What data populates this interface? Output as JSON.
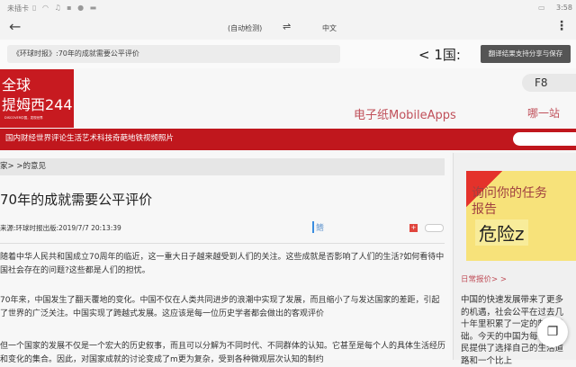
{
  "status_bar": {
    "left": "未插卡",
    "time": "3:58"
  },
  "toolbar": {
    "source_lang": "(自动检测)",
    "swap": "⇌",
    "target_lang": "中文"
  },
  "url_bar": {
    "value": "《环球时报》:70年的成就需要公平评价",
    "overlay": "< 1国:"
  },
  "tooltip": "翻译结果支持分享与保存",
  "site": {
    "logo_line1": "全球",
    "logo_line2": "提姆西244",
    "logo_tagline": "DISCOVER中国，发现世界",
    "apps_link": "电子纸MobileApps",
    "f8": "F8",
    "station": "哪一站"
  },
  "nav": {
    "items": "国内财经世界评论生活艺术科技奇葩地铁视频照片"
  },
  "breadcrumb": "家> >的意见",
  "article": {
    "title": "70年的成就需要公平评价",
    "meta": "来源:环球时报出版:2019/7/7 20:13:39",
    "font_label": "鳍",
    "paragraphs": [
      "随着中华人民共和国成立70周年的临近，这一重大日子越来越受到人们的关注。这些成就是否影响了人们的生活?如何看待中国社会存在的问题?这些都是人们的担忧。",
      "70年来，中国发生了翻天覆地的变化。中国不仅在人类共同进步的浪潮中实现了发展，而且缩小了与发达国家的差距，引起了世界的广泛关注。中国实现了跨越式发展。这应该是每一位历史学者都会做出的客观评价",
      "但一个国家的发展不仅是一个宏大的历史叙事，而且可以分解为不同时代、不同群体的认知。它甚至是每个人的具体生活经历和变化的集合。因此，对国家成就的讨论变成了m更为复杂，受到各种微观层次认知的制约"
    ]
  },
  "sidebar": {
    "ad_line1": "询问你的任务",
    "ad_line2": "报告",
    "ad_line3": "危险z",
    "section": "日常报价> >",
    "text": "中国的快速发展带来了更多的机遇，社会公平在过去几十年里积累了一定的制度基础。今天的中国为每一个公民提供了选择自己的生活道路和一个比上"
  }
}
